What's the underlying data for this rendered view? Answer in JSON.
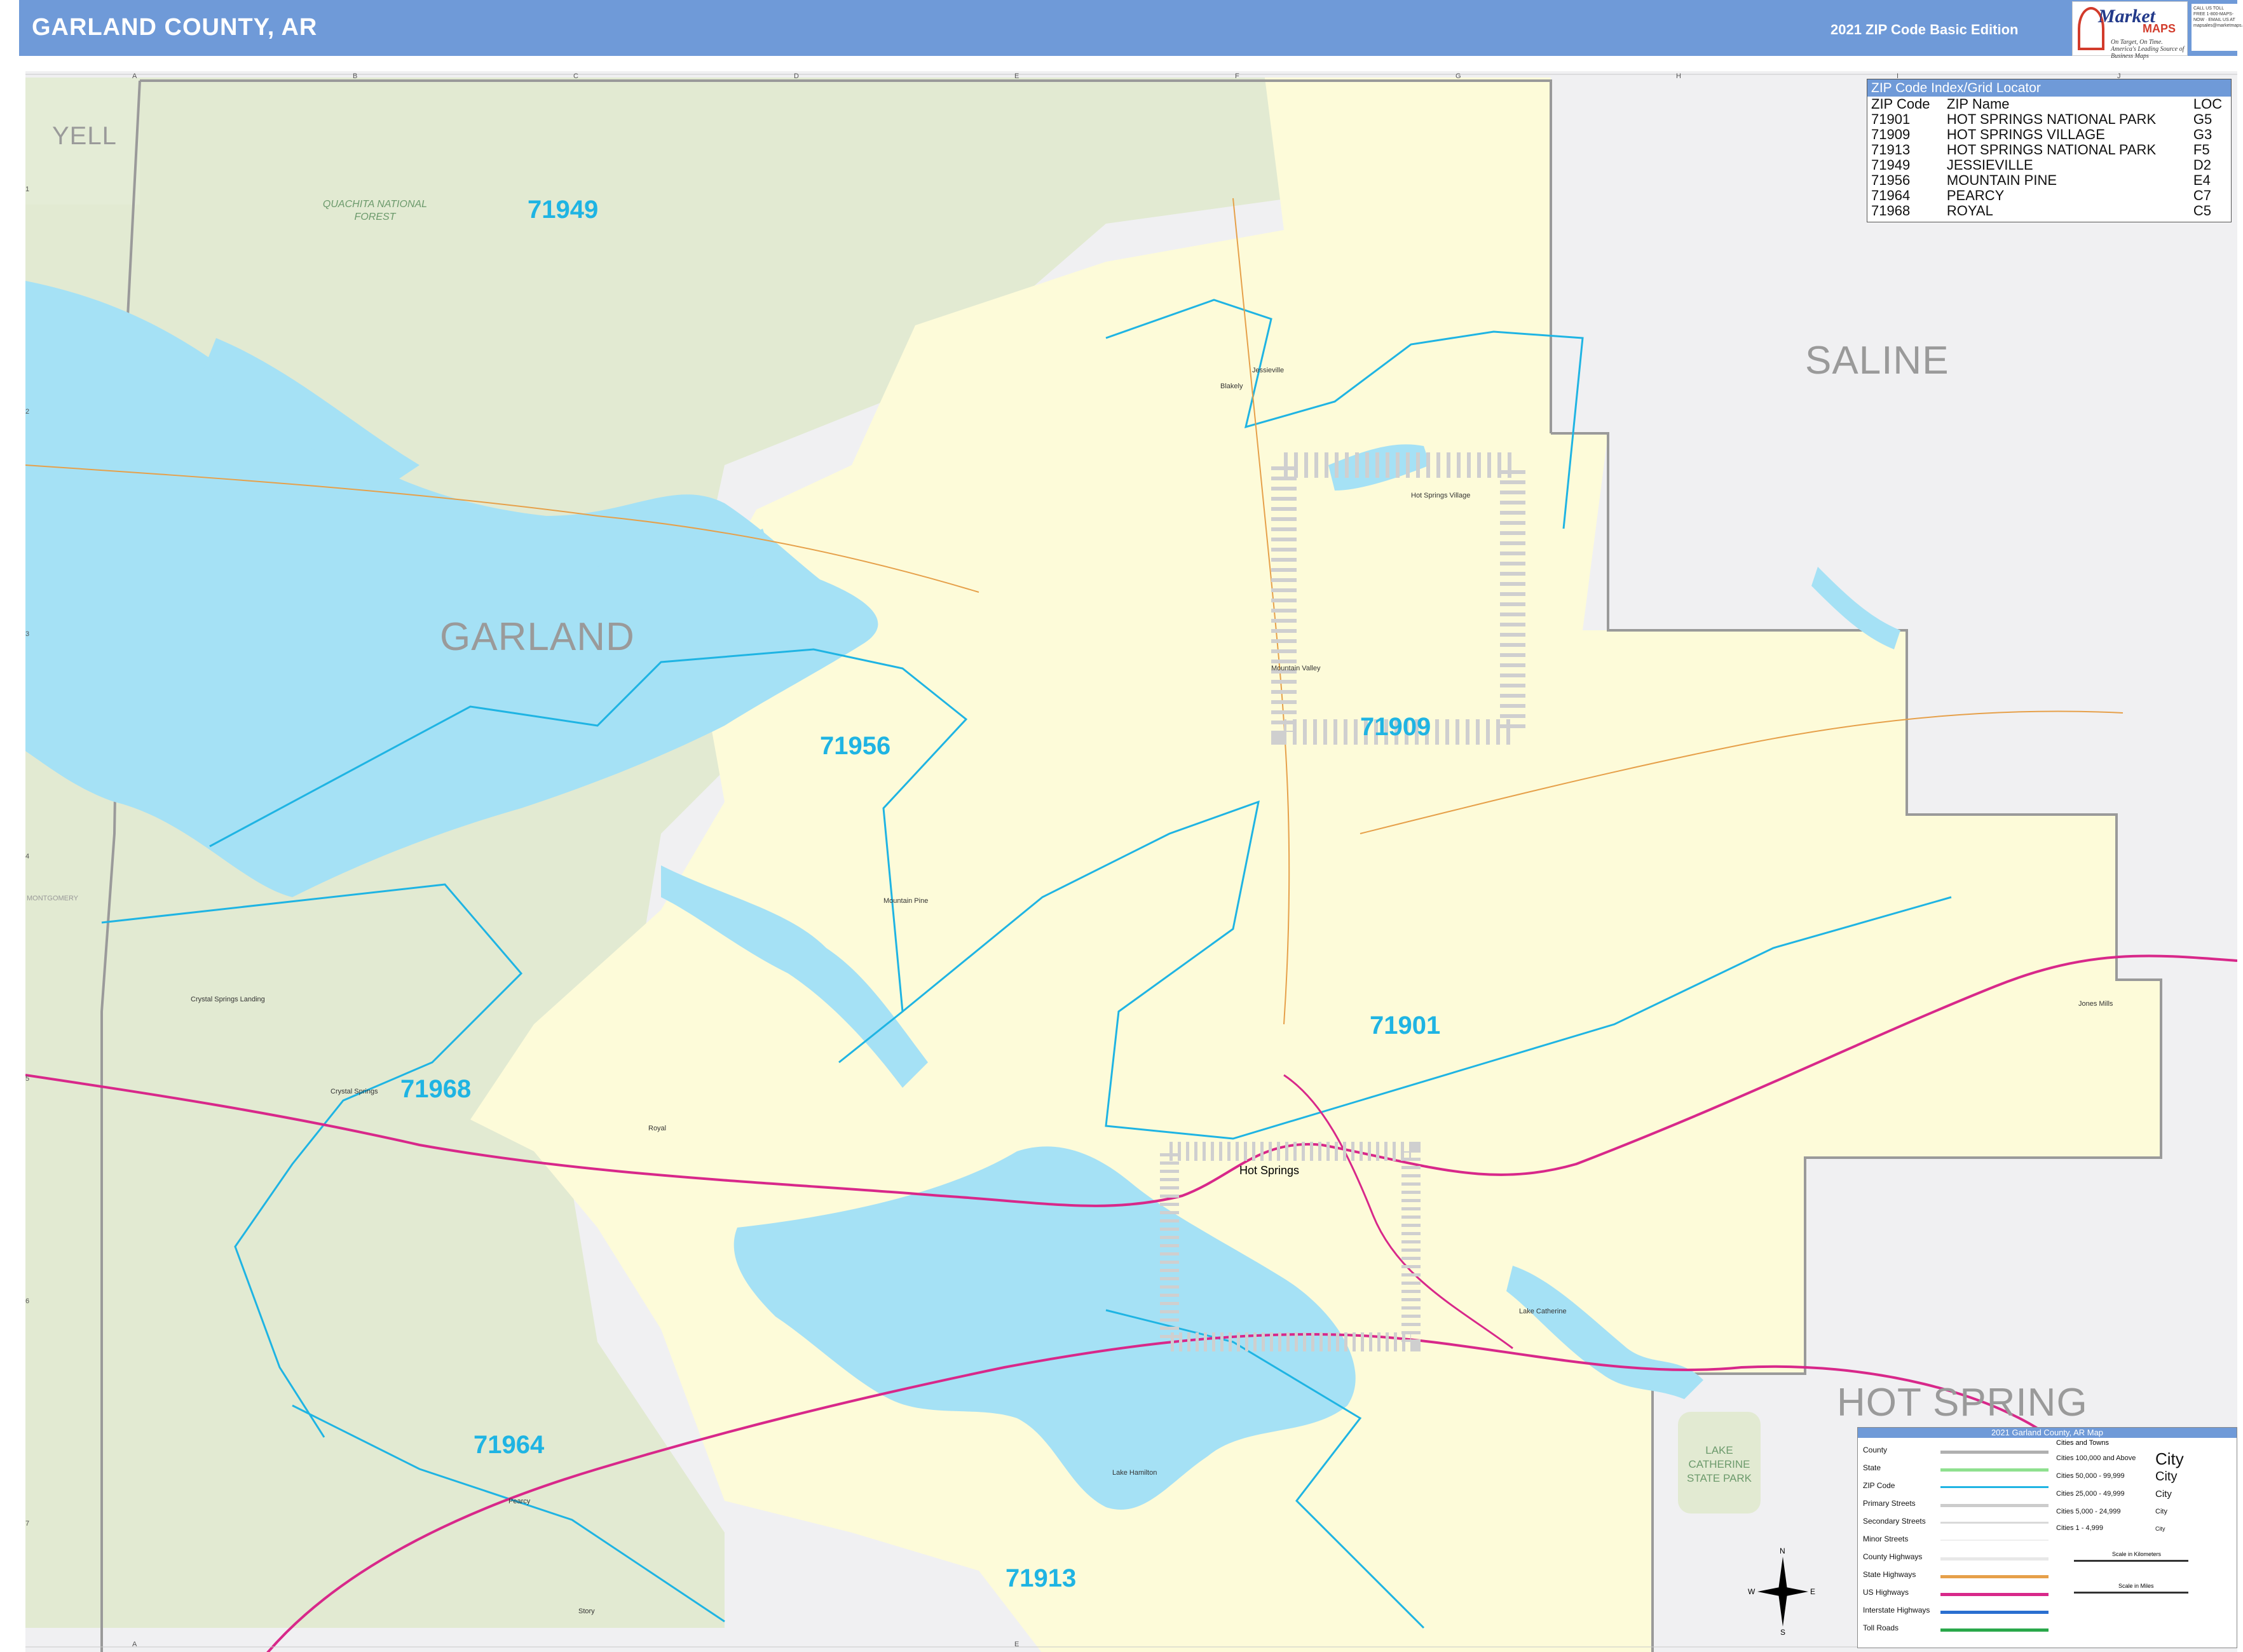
{
  "header": {
    "title": "GARLAND COUNTY, AR",
    "edition": "2021 ZIP Code Basic Edition"
  },
  "logo": {
    "name_part1": "Market",
    "name_part2": "MAPS",
    "slogan1": "On Target, On Time",
    "slogan2": "America's Leading Source of Business Maps",
    "contact": "CALL US TOLL FREE 1-800-MAPS-NOW · EMAIL US AT mapsales@marketmaps.com"
  },
  "grid": {
    "columns": [
      "A",
      "B",
      "C",
      "D",
      "E",
      "F",
      "G",
      "H",
      "I",
      "J"
    ],
    "rows": [
      "1",
      "2",
      "3",
      "4",
      "5",
      "6",
      "7"
    ]
  },
  "zip_index": {
    "heading": "ZIP Code Index/Grid Locator",
    "columns": [
      "ZIP Code",
      "ZIP Name",
      "LOC"
    ],
    "rows": [
      [
        "71901",
        "HOT SPRINGS NATIONAL PARK",
        "G5"
      ],
      [
        "71909",
        "HOT SPRINGS VILLAGE",
        "G3"
      ],
      [
        "71913",
        "HOT SPRINGS NATIONAL PARK",
        "F5"
      ],
      [
        "71949",
        "JESSIEVILLE",
        "D2"
      ],
      [
        "71956",
        "MOUNTAIN PINE",
        "E4"
      ],
      [
        "71964",
        "PEARCY",
        "C7"
      ],
      [
        "71968",
        "ROYAL",
        "C5"
      ]
    ]
  },
  "county_labels": {
    "yell": "YELL",
    "saline": "SALINE",
    "garland": "GARLAND",
    "hot_spring": "HOT SPRING",
    "montgomery": "MONTGOMERY"
  },
  "zip_labels": {
    "z71949": "71949",
    "z71956": "71956",
    "z71909": "71909",
    "z71901": "71901",
    "z71968": "71968",
    "z71964": "71964",
    "z71913": "71913"
  },
  "town_labels": {
    "jessieville": "Jessieville",
    "blakely": "Blakely",
    "hsv": "Hot Springs Village",
    "mountain_valley": "Mountain Valley",
    "mountain_pine": "Mountain Pine",
    "crystal_springs_landing": "Crystal Springs Landing",
    "crystal_springs": "Crystal Springs",
    "royal": "Royal",
    "hot_springs": "Hot Springs",
    "lake_catherine": "Lake Catherine",
    "lake_hamilton": "Lake Hamilton",
    "jones_mills": "Jones Mills",
    "pearcy": "Pearcy",
    "story": "Story"
  },
  "forest_label": "QUACHITA NATIONAL FOREST",
  "park_label": "LAKE CATHERINE STATE PARK",
  "legend": {
    "heading": "2021 Garland County, AR Map",
    "cities_heading": "Cities and Towns",
    "rows": [
      {
        "label": "County",
        "color": "#b0b0b0"
      },
      {
        "label": "State",
        "color": "#8fe08f"
      },
      {
        "label": "ZIP Code",
        "color": "#1fb4e3"
      },
      {
        "label": "Primary Streets",
        "color": "#cccccc"
      },
      {
        "label": "Secondary Streets",
        "color": "#d9d9d9"
      },
      {
        "label": "Minor Streets",
        "color": "#eeeeee"
      },
      {
        "label": "County Highways",
        "color": "#e8e8e8"
      },
      {
        "label": "State Highways",
        "color": "#e6a04a"
      },
      {
        "label": "US Highways",
        "color": "#d8288a"
      },
      {
        "label": "Interstate Highways",
        "color": "#2a6fd0"
      },
      {
        "label": "Toll Roads",
        "color": "#2aa84a"
      }
    ],
    "cities": [
      {
        "range": "Cities 100,000 and Above",
        "sample": "City"
      },
      {
        "range": "Cities 50,000 - 99,999",
        "sample": "City"
      },
      {
        "range": "Cities 25,000 - 49,999",
        "sample": "City"
      },
      {
        "range": "Cities 5,000 - 24,999",
        "sample": "City"
      },
      {
        "range": "Cities 1 - 4,999",
        "sample": "City"
      }
    ],
    "scale_km": "Scale in Kilometers",
    "scale_mi": "Scale in Miles"
  },
  "compass": {
    "n": "N",
    "s": "S",
    "e": "E",
    "w": "W"
  },
  "colors": {
    "header": "#6f9ad8",
    "county_fill": "#fdfbd9",
    "forest": "#e2ead2",
    "water": "#a5e1f5",
    "zip_line": "#1fb4e3",
    "us_highway": "#d8288a",
    "outside": "#f0f0f2"
  }
}
